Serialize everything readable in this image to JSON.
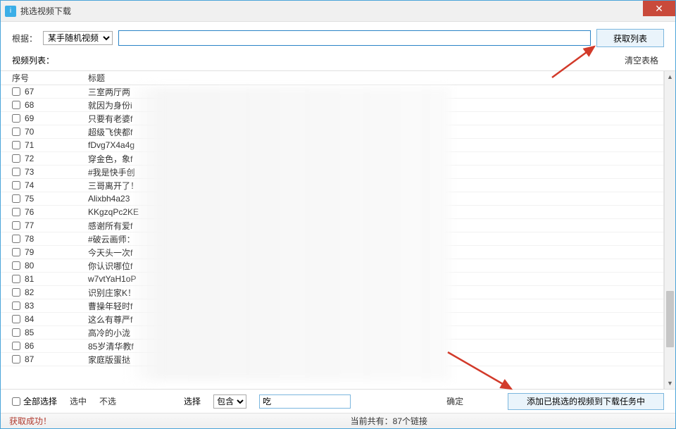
{
  "window": {
    "title": "挑选视频下载",
    "close_glyph": "✕"
  },
  "topbar": {
    "label_root": "根据：",
    "source_selected": "某手随机视频",
    "source_options": [
      "某手随机视频"
    ],
    "url_value": "",
    "btn_getlist": "获取列表"
  },
  "listlabel": {
    "text": "视频列表：",
    "clear_text": "清空表格"
  },
  "table": {
    "header_seq": "序号",
    "header_title": "标题",
    "rows": [
      {
        "seq": "67",
        "title": "三室两厅两"
      },
      {
        "seq": "68",
        "title": "就因为身份i"
      },
      {
        "seq": "69",
        "title": "只要有老婆f"
      },
      {
        "seq": "70",
        "title": "超级飞侠都f"
      },
      {
        "seq": "71",
        "title": "fDvg7X4a4g"
      },
      {
        "seq": "72",
        "title": "穿金色，象f"
      },
      {
        "seq": "73",
        "title": "#我是快手创"
      },
      {
        "seq": "74",
        "title": "三哥离开了！"
      },
      {
        "seq": "75",
        "title": "Alixbh4a23"
      },
      {
        "seq": "76",
        "title": "KKgzqPc2KE"
      },
      {
        "seq": "77",
        "title": "感谢所有爱f"
      },
      {
        "seq": "78",
        "title": "#破云画师："
      },
      {
        "seq": "79",
        "title": "今天头一次f"
      },
      {
        "seq": "80",
        "title": "你认识哪位f"
      },
      {
        "seq": "81",
        "title": "w7vtYaH1oP"
      },
      {
        "seq": "82",
        "title": "识别庄家K！"
      },
      {
        "seq": "83",
        "title": "曹操年轻时f"
      },
      {
        "seq": "84",
        "title": "这么有尊严f"
      },
      {
        "seq": "85",
        "title": "高冷的小泷"
      },
      {
        "seq": "86",
        "title": "85岁清华教f"
      },
      {
        "seq": "87",
        "title": "家庭版蛋挞"
      }
    ]
  },
  "footer": {
    "select_all": "全部选择",
    "check_selected": "选中",
    "uncheck": "不选",
    "select_label": "选择",
    "mode_selected": "包含",
    "mode_options": [
      "包含"
    ],
    "filter_text": "吃",
    "confirm": "确定",
    "btn_addtask": "添加已挑选的视频到下载任务中"
  },
  "status": {
    "left": "获取成功！",
    "right": "当前共有：87个链接"
  },
  "arrows": {
    "color": "#d23a2a"
  }
}
